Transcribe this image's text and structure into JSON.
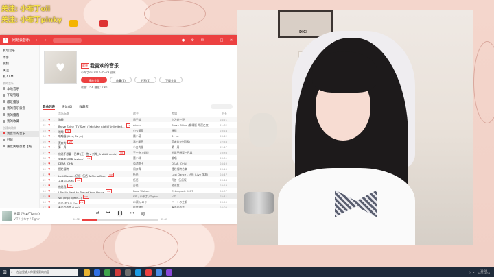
{
  "overlay": {
    "line1": "关注: 小布丁oii",
    "line2": "关注: 小布丁pinky"
  },
  "desktop_icons": [
    {
      "label": "",
      "color": "#f4b400",
      "icon": "folder-icon"
    },
    {
      "label": "",
      "color": "#3c7be8",
      "icon": "app-icon"
    },
    {
      "label": "",
      "color": "#d33",
      "icon": "app-icon"
    }
  ],
  "music_app": {
    "title": "网易云音乐",
    "sidebar": {
      "items": [
        {
          "label": "发现音乐",
          "active": false
        },
        {
          "label": "博客",
          "active": false
        },
        {
          "label": "视频",
          "active": false
        },
        {
          "label": "关注",
          "active": false
        },
        {
          "label": "私人FM",
          "active": false
        }
      ],
      "section_mine": "我的音乐",
      "mine_items": [
        "本地音乐",
        "下载管理",
        "最近播放",
        "我的音乐云盘",
        "我的播客",
        "我的收藏"
      ],
      "section_playlists": "创建的歌单",
      "playlists": [
        {
          "label": "我喜欢的音乐",
          "active": true
        },
        {
          "label": "好听",
          "active": false
        },
        {
          "label": "重度失眠患者【纯...",
          "active": false
        }
      ]
    },
    "playlist": {
      "tag": "歌单",
      "title": "我喜欢的音乐",
      "creator": "小布丁oii  2017-05-29 创建",
      "btn_play": "播放全部",
      "btn_fav": "收藏(0)",
      "btn_share": "分享(0)",
      "btn_download": "下载全部",
      "stats": "歌曲: 156    播放: 7982",
      "tabs": [
        "歌曲列表",
        "评论(0)",
        "收藏者"
      ],
      "headers": {
        "title": "音乐标题",
        "artist": "歌手",
        "album": "专辑",
        "duration": "时长"
      },
      "songs": [
        {
          "idx": "01",
          "title": "海獭",
          "vip": false,
          "artist": "周子琰",
          "album": "何为谢一野",
          "dur": "04:21"
        },
        {
          "idx": "02",
          "title": "Brave Shine (TV Size) (Fate/stay night [Unlimited...",
          "vip": true,
          "artist": "Aimer",
          "album": "Brave Shine (劇場版 命運之夜)",
          "dur": "01:32"
        },
        {
          "idx": "03",
          "title": "嘿嘿",
          "vip": true,
          "artist": "小卡萌萌",
          "album": "嘿嘿",
          "dur": "03:24"
        },
        {
          "idx": "04",
          "title": "喵喵喵 (Live, 6v ya)",
          "vip": false,
          "artist": "晨小萌",
          "album": "6v ya",
          "dur": "03:42"
        },
        {
          "idx": "05",
          "title": "荒废的",
          "vip": true,
          "artist": "温小丽茜",
          "album": "荒废的 (中国风)",
          "dur": "02:58"
        },
        {
          "idx": "06",
          "title": "第一周",
          "vip": false,
          "artist": "小白的猫",
          "album": "第一周",
          "dur": "02:47"
        },
        {
          "idx": "07",
          "title": "他说不想要一巴掌 (王一抱 x 刘烨_Crabbit remix)",
          "vip": true,
          "artist": "王一抱 / 刘烨",
          "album": "他说不想要一巴掌",
          "dur": "03:36"
        },
        {
          "idx": "08",
          "title": "安静的 (翻唱 jealous)",
          "vip": true,
          "artist": "董小咪",
          "album": "翻唱",
          "dur": "03:01"
        },
        {
          "idx": "09",
          "title": "DEAR JOHN",
          "vip": false,
          "artist": "菊池桃子",
          "album": "DEAR JOHN",
          "dur": "04:10"
        },
        {
          "idx": "10",
          "title": "摆烂福特",
          "vip": false,
          "artist": "周彦霖",
          "album": "摆烂福特合集",
          "dur": "03:15"
        },
        {
          "idx": "11",
          "title": "Last Dance - 伍佰 (伍佰 & China Blue)",
          "vip": true,
          "artist": "伍佰",
          "album": "Last Dance - 伍佰 (Live 版本)",
          "dur": "04:47"
        },
        {
          "idx": "12",
          "title": "开普 (伍佰版)",
          "vip": true,
          "artist": "伍佰",
          "album": "开普 (伍佰版)",
          "dur": "03:48"
        },
        {
          "idx": "13",
          "title": "他说我",
          "vip": true,
          "artist": "彭佳",
          "album": "他说我",
          "dur": "03:23"
        },
        {
          "idx": "14",
          "title": "I Really Want to Stay at Your House",
          "vip": true,
          "artist": "Rosa Walton",
          "album": "Cyberpunk 2077",
          "dur": "04:07"
        },
        {
          "idx": "15",
          "title": "VIT (Vsp/Tightn...)",
          "vip": true,
          "artist": "VIT / 小布丁 / Tightn",
          "album": "VIT",
          "dur": "02:41",
          "playing": true
        },
        {
          "idx": "16",
          "title": "夏の ミステリー",
          "vip": true,
          "artist": "水瀬 いのり",
          "album": "ハートの主張",
          "dur": "03:50"
        },
        {
          "idx": "17",
          "title": "春の女の音 (Live)",
          "vip": false,
          "artist": "佐倉綾音",
          "album": "春の女の音",
          "dur": "04:02"
        }
      ]
    },
    "player": {
      "title": "枯燥  (Vsp/Tightn)",
      "artist": "VIT / 小布丁 / Tightn",
      "time_current": "00:32",
      "time_total": "02:41",
      "progress": 0.2
    }
  },
  "taskbar": {
    "search_placeholder": "在这里输入你要搜索的内容",
    "time": "12:03",
    "date": "2021/4/23",
    "apps": [
      {
        "color": "#e9b432"
      },
      {
        "color": "#2f6fe3"
      },
      {
        "color": "#3ea44b"
      },
      {
        "color": "#cf3b3b"
      },
      {
        "color": "#6d6d6d"
      },
      {
        "color": "#1d9be3"
      },
      {
        "color": "#ec4141"
      },
      {
        "color": "#4a8de6"
      },
      {
        "color": "#8a4ad9"
      }
    ]
  }
}
